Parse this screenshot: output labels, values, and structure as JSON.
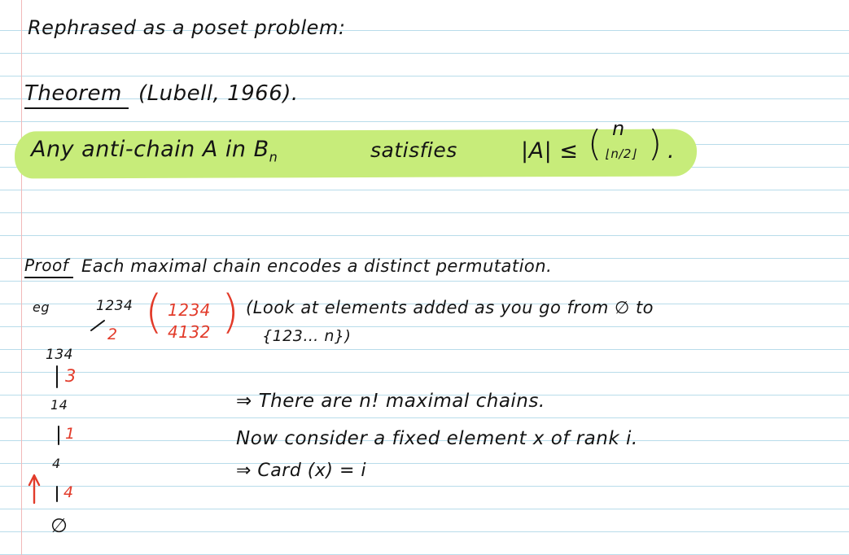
{
  "heading": "Rephrased as a poset problem:",
  "theorem": {
    "label": "Theorem",
    "attribution": "(Lubell, 1966).",
    "statement": "Any anti-chain A in B",
    "statement_sub": "n",
    "satisfies": "satisfies",
    "bound_lhs": "|A| ≤",
    "binom_top": "n",
    "binom_bottom": "⌊n/2⌋",
    "bound_end": "."
  },
  "proof": {
    "label": "Proof",
    "line1": "Each maximal chain encodes a distinct permutation.",
    "eg_label": "eg",
    "chain_top": "1234",
    "perm_top": "1234",
    "perm_bottom": "4132",
    "look_line1": "(Look at elements added as you go from ∅ to",
    "look_line2": "{123… n})",
    "chain": [
      {
        "set": "134",
        "step": "2"
      },
      {
        "set": "14",
        "step": "3"
      },
      {
        "set": "4",
        "step": "1"
      },
      {
        "set": "∅",
        "step": "4"
      }
    ],
    "result1": "⇒ There are n! maximal chains.",
    "result2": "Now consider a fixed element x of rank i.",
    "result3": "⇒ Card (x) = i"
  },
  "colors": {
    "ink": "#141414",
    "red": "#e23b2a",
    "highlight": "#c7ec7a",
    "ruled_line": "#b8dcea",
    "margin": "#f1b9b9"
  }
}
